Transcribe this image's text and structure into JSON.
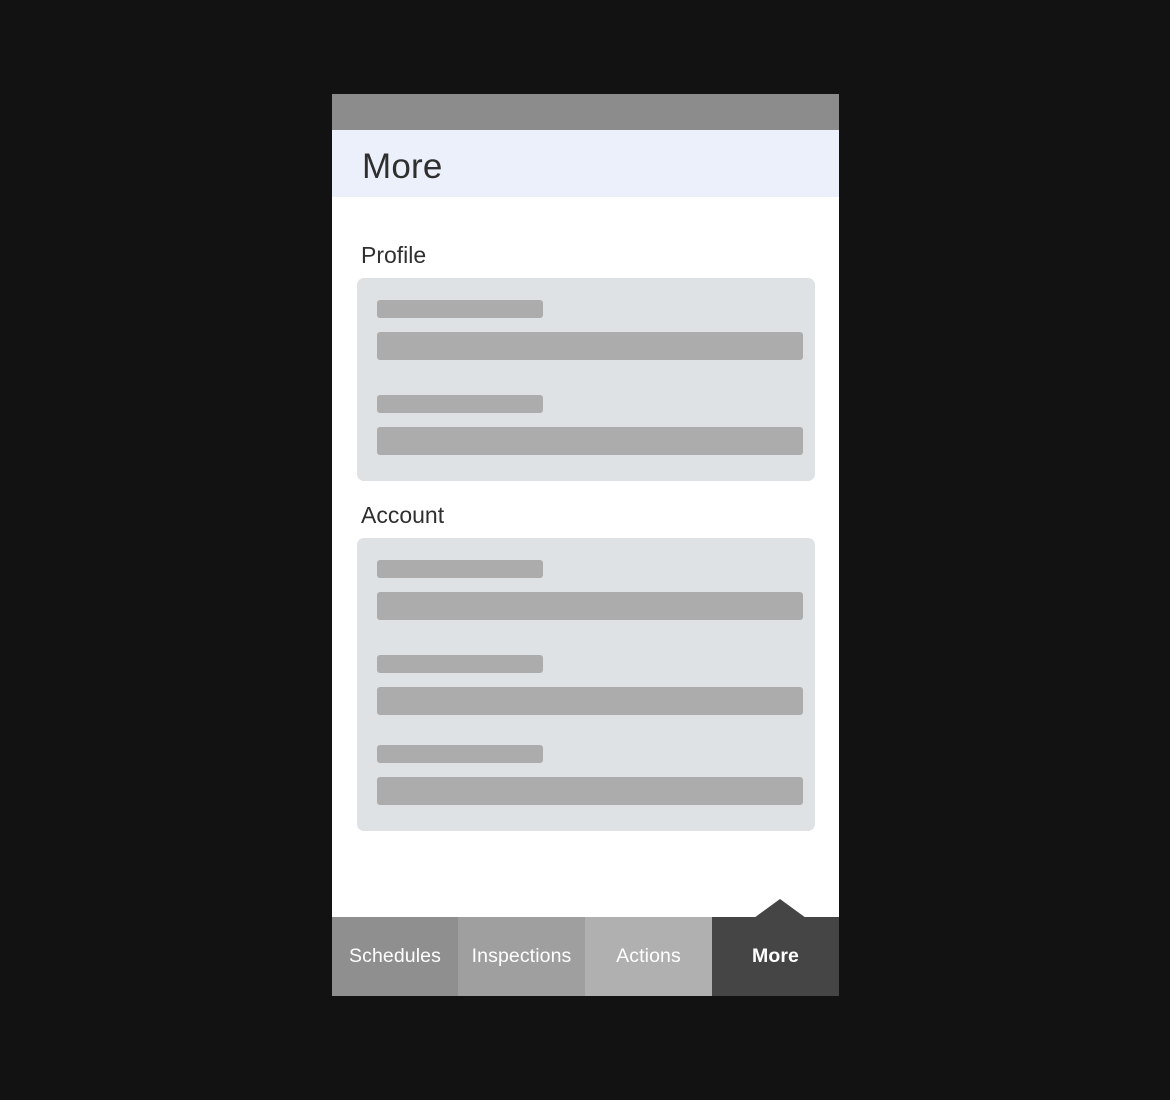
{
  "header": {
    "title": "More"
  },
  "sections": {
    "profile": {
      "title": "Profile"
    },
    "account": {
      "title": "Account"
    }
  },
  "bottom_nav": {
    "tabs": [
      {
        "label": "Schedules"
      },
      {
        "label": "Inspections"
      },
      {
        "label": "Actions"
      },
      {
        "label": "More",
        "active": true
      }
    ]
  },
  "colors": {
    "background": "#121212",
    "header_bg": "#ecf0fa",
    "status_bar": "#8c8c8c",
    "card_bg": "#dfe2e5",
    "placeholder": "#acacac",
    "active_tab": "#454545"
  }
}
